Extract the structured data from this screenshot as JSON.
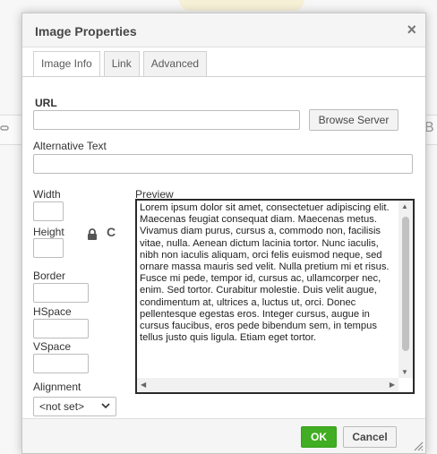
{
  "background": {
    "right_text": "B"
  },
  "dialog": {
    "title": "Image Properties",
    "close_symbol": "×",
    "tabs": [
      {
        "label": "Image Info",
        "active": true
      },
      {
        "label": "Link",
        "active": false
      },
      {
        "label": "Advanced",
        "active": false
      }
    ],
    "url": {
      "label": "URL",
      "value": ""
    },
    "browse_button": "Browse Server",
    "alt_text": {
      "label": "Alternative Text",
      "value": ""
    },
    "width": {
      "label": "Width",
      "value": ""
    },
    "height": {
      "label": "Height",
      "value": ""
    },
    "lock_icon": "lock-icon",
    "reset_icon": "reset-size-icon",
    "reset_symbol": "C",
    "border": {
      "label": "Border",
      "value": ""
    },
    "hspace": {
      "label": "HSpace",
      "value": ""
    },
    "vspace": {
      "label": "VSpace",
      "value": ""
    },
    "alignment": {
      "label": "Alignment",
      "selected": "<not set>"
    },
    "preview": {
      "label": "Preview",
      "text": "Lorem ipsum dolor sit amet, consectetuer adipiscing elit. Maecenas feugiat consequat diam. Maecenas metus. Vivamus diam purus, cursus a, commodo non, facilisis vitae, nulla. Aenean dictum lacinia tortor. Nunc iaculis, nibh non iaculis aliquam, orci felis euismod neque, sed ornare massa mauris sed velit. Nulla pretium mi et risus. Fusce mi pede, tempor id, cursus ac, ullamcorper nec, enim. Sed tortor. Curabitur molestie. Duis velit augue, condimentum at, ultrices a, luctus ut, orci. Donec pellentesque egestas eros. Integer cursus, augue in cursus faucibus, eros pede bibendum sem, in tempus tellus justo quis ligula. Etiam eget tortor."
    },
    "ok_button": "OK",
    "cancel_button": "Cancel"
  },
  "colors": {
    "ok_green": "#40ad22"
  }
}
